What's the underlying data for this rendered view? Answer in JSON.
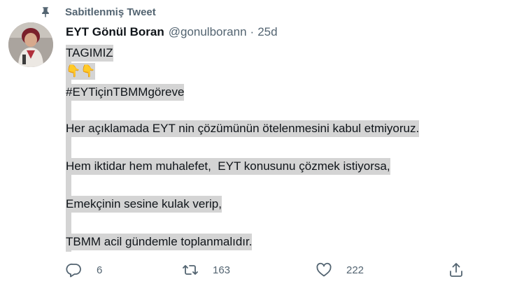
{
  "pinned": {
    "label": "Sabitlenmiş Tweet",
    "icon": "pin-icon"
  },
  "tweet": {
    "author_name": "EYT Gönül Boran",
    "handle": "@gonulborann",
    "separator": "·",
    "time": "25d",
    "lines": [
      "TAGIMIZ",
      "👇👇",
      "#EYTiçinTBMMgöreve",
      "",
      "Her açıklamada EYT nin çözümünün ötelenmesini kabul etmiyoruz.",
      "",
      "Hem iktidar hem muhalefet,  EYT konusunu çözmek istiyorsa,",
      "",
      "Emekçinin sesine kulak verip,",
      "",
      "TBMM acil gündemle toplanmalıdır."
    ]
  },
  "actions": {
    "reply": {
      "icon": "reply-icon",
      "count": "6"
    },
    "retweet": {
      "icon": "retweet-icon",
      "count": "163"
    },
    "like": {
      "icon": "heart-icon",
      "count": "222"
    },
    "share": {
      "icon": "share-icon"
    }
  },
  "colors": {
    "secondary_text": "#536471",
    "selection": "#d4d4d4",
    "primary_text": "#0f1419"
  }
}
